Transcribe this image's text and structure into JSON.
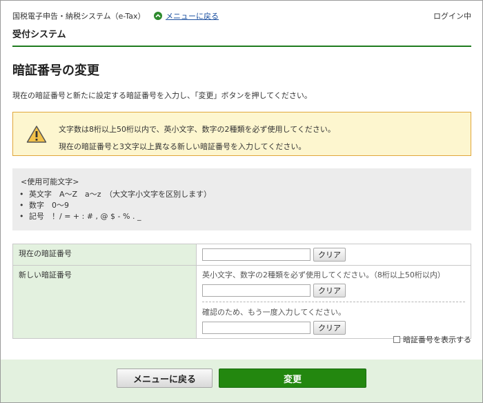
{
  "header": {
    "system_name": "国税電子申告・納税システム（e-Tax）",
    "menu_link": "メニューに戻る",
    "login_status": "ログイン中",
    "subsystem": "受付システム"
  },
  "page": {
    "title": "暗証番号の変更",
    "instruction": "現在の暗証番号と新たに設定する暗証番号を入力し、「変更」ボタンを押してください。"
  },
  "warning": {
    "lines": [
      "文字数は8桁以上50桁以内で、英小文字、数字の2種類を必ず使用してください。",
      "現在の暗証番号と3文字以上異なる新しい暗証番号を入力してください。"
    ]
  },
  "allowed_chars": {
    "title": "<使用可能文字>",
    "items": [
      {
        "label": "英文字",
        "value": "A～Z　a～z　（大文字小文字を区別します）"
      },
      {
        "label": "数字",
        "value": "0～9"
      },
      {
        "label": "記号",
        "value": "！/ = + : # , @ $ - % . _"
      }
    ]
  },
  "form": {
    "current_label": "現在の暗証番号",
    "current_value": "",
    "new_label": "新しい暗証番号",
    "new_hint": "英小文字、数字の2種類を必ず使用してください。（8桁以上50桁以内）",
    "new_value": "",
    "confirm_hint": "確認のため、もう一度入力してください。",
    "confirm_value": "",
    "clear_label": "クリア",
    "show_password_label": "暗証番号を表示する",
    "show_password_checked": false
  },
  "footer": {
    "back_label": "メニューに戻る",
    "submit_label": "変更"
  },
  "colors": {
    "accent_green": "#23870f",
    "label_bg": "#e3f1df",
    "warning_bg": "#fdf6cf",
    "warning_border": "#e0a63a",
    "link_blue": "#1a4fa0"
  }
}
